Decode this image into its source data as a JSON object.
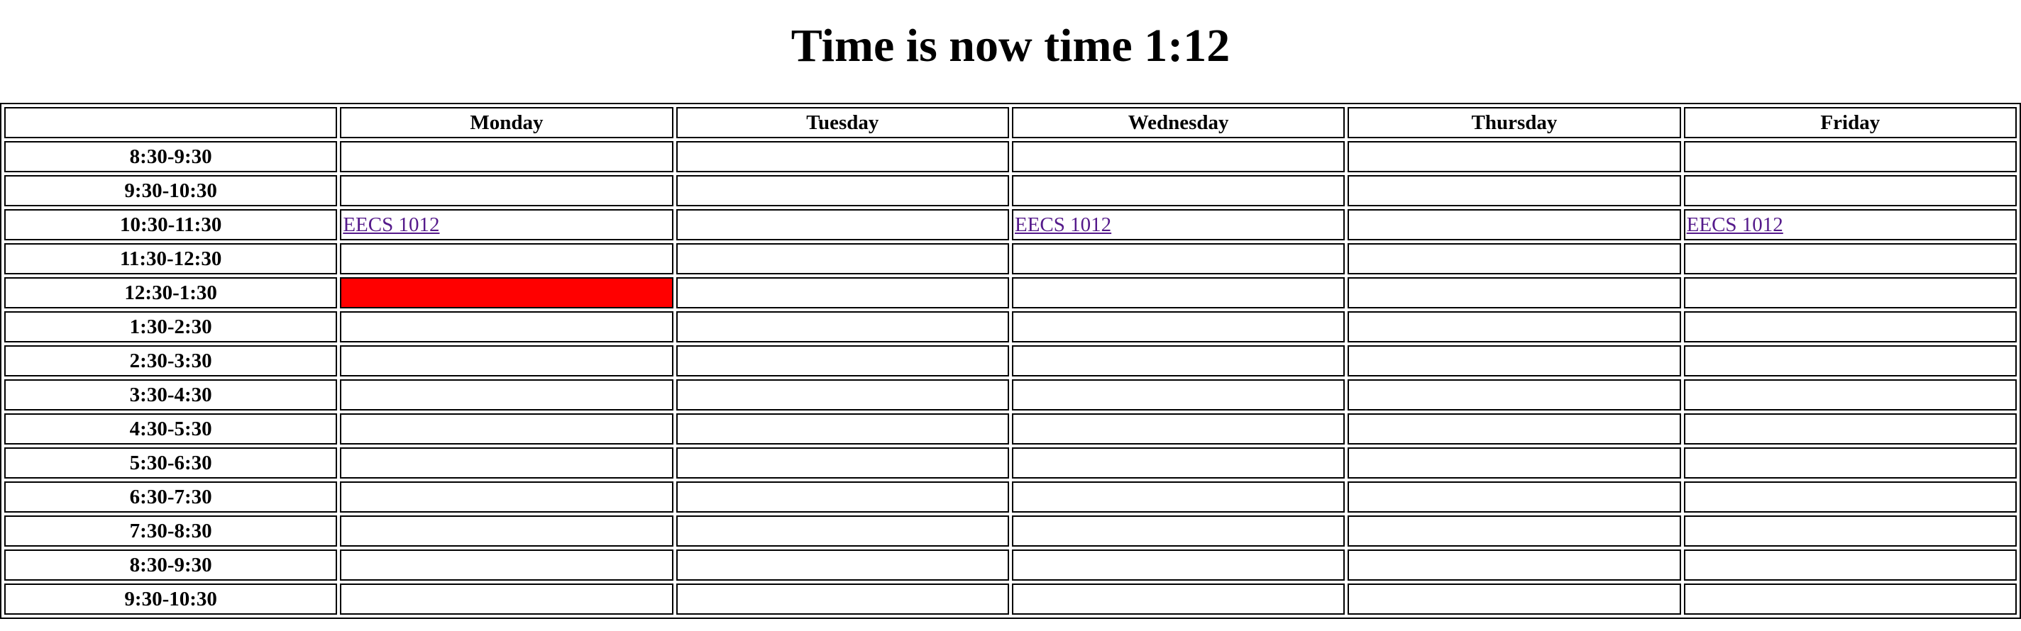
{
  "heading": "Time is now time 1:12",
  "days": [
    "Monday",
    "Tuesday",
    "Wednesday",
    "Thursday",
    "Friday"
  ],
  "rows": [
    {
      "time": "8:30-9:30",
      "cells": [
        "",
        "",
        "",
        "",
        ""
      ]
    },
    {
      "time": "9:30-10:30",
      "cells": [
        "",
        "",
        "",
        "",
        ""
      ]
    },
    {
      "time": "10:30-11:30",
      "cells": [
        "EECS 1012",
        "",
        "EECS 1012",
        "",
        "EECS 1012"
      ]
    },
    {
      "time": "11:30-12:30",
      "cells": [
        "",
        "",
        "",
        "",
        ""
      ]
    },
    {
      "time": "12:30-1:30",
      "cells": [
        "",
        "",
        "",
        "",
        ""
      ]
    },
    {
      "time": "1:30-2:30",
      "cells": [
        "",
        "",
        "",
        "",
        ""
      ]
    },
    {
      "time": "2:30-3:30",
      "cells": [
        "",
        "",
        "",
        "",
        ""
      ]
    },
    {
      "time": "3:30-4:30",
      "cells": [
        "",
        "",
        "",
        "",
        ""
      ]
    },
    {
      "time": "4:30-5:30",
      "cells": [
        "",
        "",
        "",
        "",
        ""
      ]
    },
    {
      "time": "5:30-6:30",
      "cells": [
        "",
        "",
        "",
        "",
        ""
      ]
    },
    {
      "time": "6:30-7:30",
      "cells": [
        "",
        "",
        "",
        "",
        ""
      ]
    },
    {
      "time": "7:30-8:30",
      "cells": [
        "",
        "",
        "",
        "",
        ""
      ]
    },
    {
      "time": "8:30-9:30",
      "cells": [
        "",
        "",
        "",
        "",
        ""
      ]
    },
    {
      "time": "9:30-10:30",
      "cells": [
        "",
        "",
        "",
        "",
        ""
      ]
    }
  ],
  "highlight": {
    "row": 4,
    "day": 0,
    "color": "#ff0000"
  },
  "colors": {
    "link": "#551a8b",
    "border": "#000000",
    "highlight": "#ff0000"
  }
}
